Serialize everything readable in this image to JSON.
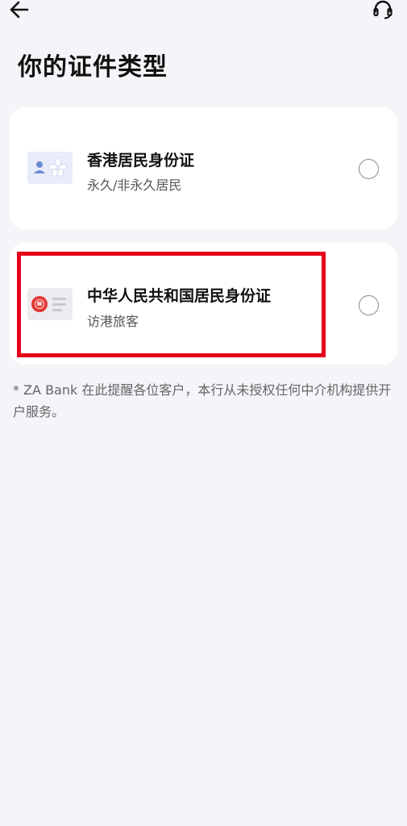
{
  "header": {
    "back_icon": "arrow-left-icon",
    "support_icon": "headset-icon"
  },
  "page": {
    "title": "你的证件类型"
  },
  "options": [
    {
      "title": "香港居民身份证",
      "subtitle": "永久/非永久居民",
      "icon": "hk-id-card-icon",
      "selected": false
    },
    {
      "title": "中华人民共和国居民身份证",
      "subtitle": "访港旅客",
      "icon": "prc-id-card-icon",
      "selected": false
    }
  ],
  "disclaimer": "* ZA Bank 在此提醒各位客户，本行从未授权任何中介机构提供开户服务。",
  "colors": {
    "background": "#f4f4f9",
    "card": "#ffffff",
    "highlight": "#e5001a"
  }
}
